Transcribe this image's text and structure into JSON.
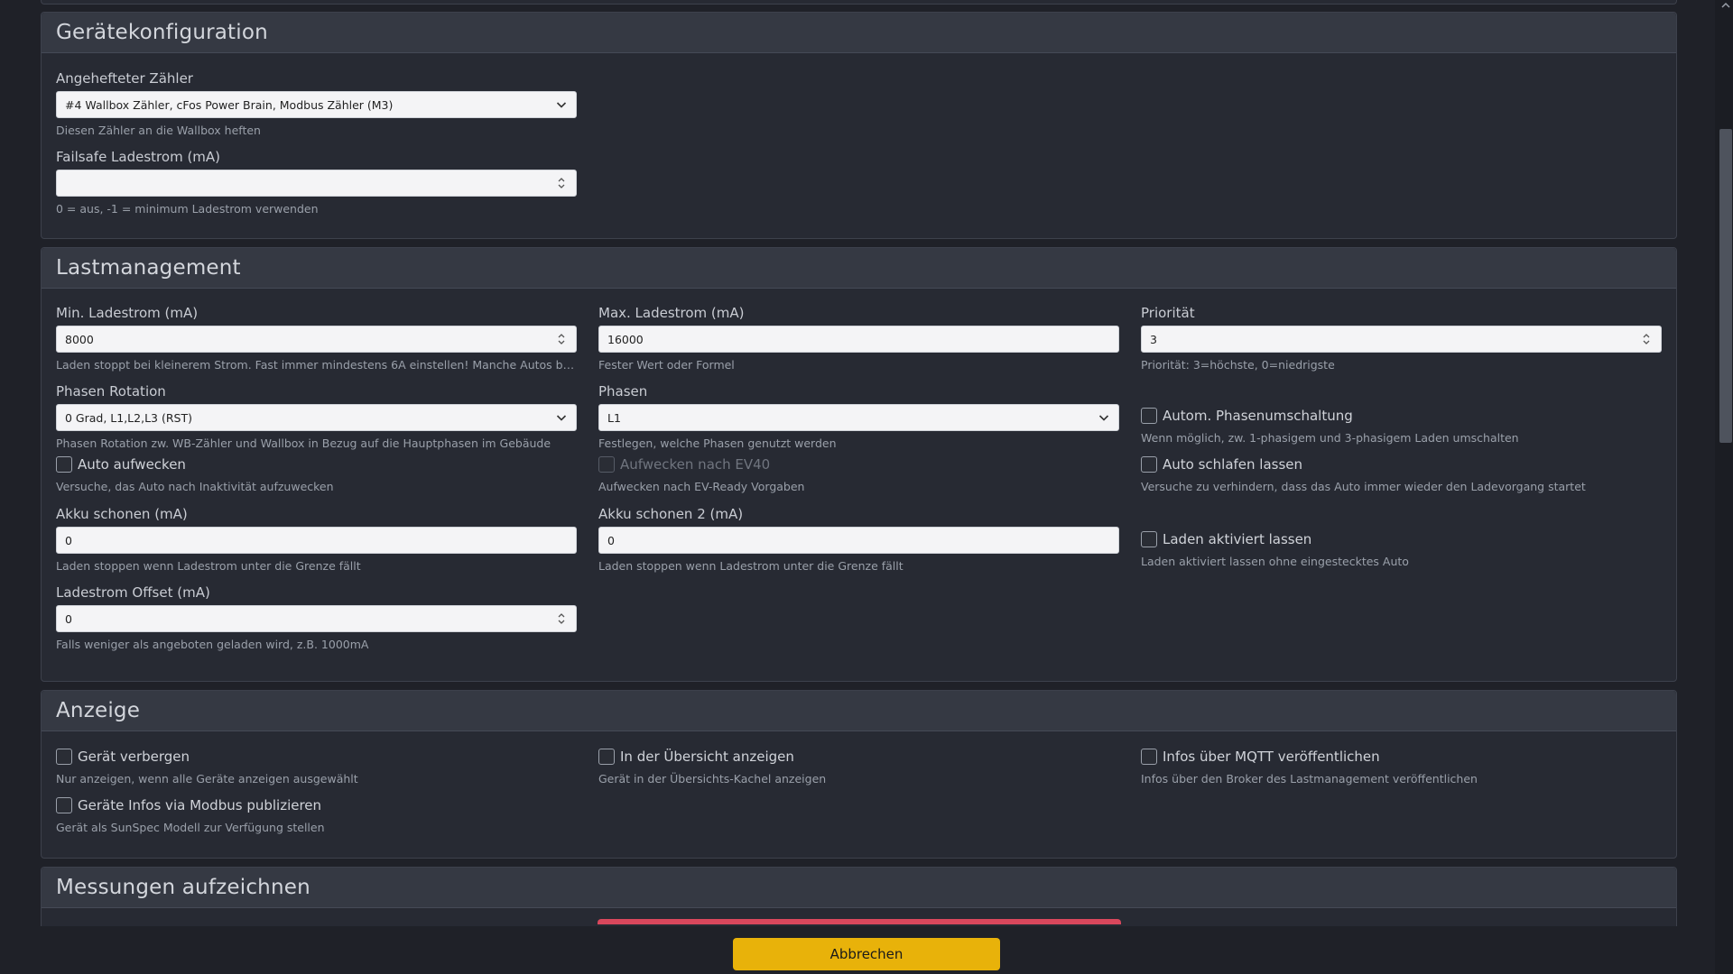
{
  "sections": {
    "geraetekonfiguration": {
      "title": "Gerätekonfiguration",
      "meter": {
        "label": "Angehefteter Zähler",
        "value": "#4 Wallbox Zähler, cFos Power Brain, Modbus Zähler (M3)",
        "help": "Diesen Zähler an die Wallbox heften"
      },
      "failsafe": {
        "label": "Failsafe Ladestrom (mA)",
        "value": "",
        "help": "0 = aus, -1 = minimum Ladestrom verwenden"
      }
    },
    "lastmanagement": {
      "title": "Lastmanagement",
      "min_current": {
        "label": "Min. Ladestrom (mA)",
        "value": "8000",
        "help": "Laden stoppt bei kleinerem Strom. Fast immer mindestens 6A einstellen! Manche Autos benötigen mehr Strom"
      },
      "max_current": {
        "label": "Max. Ladestrom (mA)",
        "value": "16000",
        "help": "Fester Wert oder Formel"
      },
      "priority": {
        "label": "Priorität",
        "value": "3",
        "help": "Priorität: 3=höchste, 0=niedrigste"
      },
      "phase_rotation": {
        "label": "Phasen Rotation",
        "value": "0 Grad, L1,L2,L3 (RST)",
        "help": "Phasen Rotation zw. WB-Zähler und Wallbox in Bezug auf die Hauptphasen im Gebäude"
      },
      "phases": {
        "label": "Phasen",
        "value": "L1",
        "help": "Festlegen, welche Phasen genutzt werden"
      },
      "auto_phase_switch": {
        "label": "Autom. Phasenumschaltung",
        "help": "Wenn möglich, zw. 1-phasigem und 3-phasigem Laden umschalten"
      },
      "wake_up": {
        "label": "Auto aufwecken",
        "help": "Versuche, das Auto nach Inaktivität aufzuwecken"
      },
      "wake_ev40": {
        "label": "Aufwecken nach EV40",
        "help": "Aufwecken nach EV-Ready Vorgaben"
      },
      "let_sleep": {
        "label": "Auto schlafen lassen",
        "help": "Versuche zu verhindern, dass das Auto immer wieder den Ladevorgang startet"
      },
      "battery_save": {
        "label": "Akku schonen (mA)",
        "value": "0",
        "help": "Laden stoppen wenn Ladestrom unter die Grenze fällt"
      },
      "battery_save2": {
        "label": "Akku schonen 2 (mA)",
        "value": "0",
        "help": "Laden stoppen wenn Ladestrom unter die Grenze fällt"
      },
      "keep_enabled": {
        "label": "Laden aktiviert lassen",
        "help": "Laden aktiviert lassen ohne eingestecktes Auto"
      },
      "offset": {
        "label": "Ladestrom Offset (mA)",
        "value": "0",
        "help": "Falls weniger als angeboten geladen wird, z.B. 1000mA"
      }
    },
    "anzeige": {
      "title": "Anzeige",
      "hide_device": {
        "label": "Gerät verbergen",
        "help": "Nur anzeigen, wenn alle Geräte anzeigen ausgewählt"
      },
      "show_overview": {
        "label": "In der Übersicht anzeigen",
        "help": "Gerät in der Übersichts-Kachel anzeigen"
      },
      "mqtt": {
        "label": "Infos über MQTT veröffentlichen",
        "help": "Infos über den Broker des Lastmanagement veröffentlichen"
      },
      "modbus": {
        "label": "Geräte Infos via Modbus publizieren",
        "help": "Gerät als SunSpec Modell zur Verfügung stellen"
      }
    },
    "messungen": {
      "title": "Messungen aufzeichnen"
    }
  },
  "footer": {
    "cancel_label": "Abbrechen"
  },
  "colors": {
    "accent_button": "#e8b20a",
    "danger": "#d9475c",
    "background": "#1f2128",
    "card": "#272a33"
  }
}
